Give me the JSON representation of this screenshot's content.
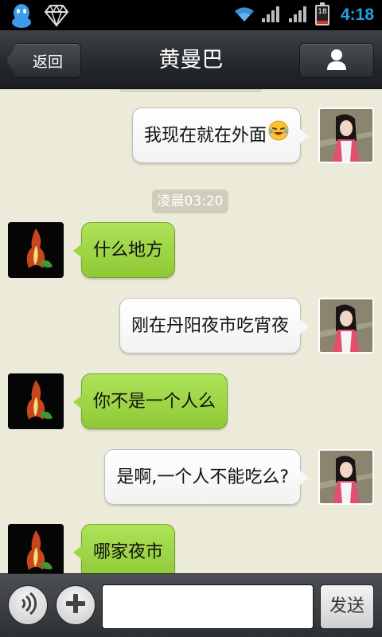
{
  "status_bar": {
    "time": "4:18",
    "battery": {
      "text": "18",
      "level": 0.18,
      "color": "#d23a24"
    },
    "icons": [
      "qq-icon",
      "diamond-icon",
      "wifi-icon",
      "signal-icon",
      "signal-icon",
      "battery-icon"
    ]
  },
  "header": {
    "back_label": "返回",
    "title": "黄曼巴",
    "profile_icon": "person-icon"
  },
  "chat": {
    "time_separator": "凌晨03:20",
    "messages": [
      {
        "side": "sent",
        "text": "我现在就在外面",
        "emoji": "laughing-tears-icon"
      },
      {
        "side": "received",
        "text": "什么地方"
      },
      {
        "side": "sent",
        "text": "刚在丹阳夜市吃宵夜"
      },
      {
        "side": "received",
        "text": "你不是一个人么"
      },
      {
        "side": "sent",
        "text": "是啊,一个人不能吃么?"
      },
      {
        "side": "received",
        "text": "哪家夜市"
      }
    ]
  },
  "input_bar": {
    "voice_icon": "voice-icon",
    "plus_icon": "plus-icon",
    "input_value": "",
    "input_placeholder": "",
    "send_label": "发送"
  },
  "colors": {
    "background": "#ecebd9",
    "received_bubble": "#9fd647",
    "sent_bubble": "#ffffff",
    "clock": "#27a0e6"
  }
}
